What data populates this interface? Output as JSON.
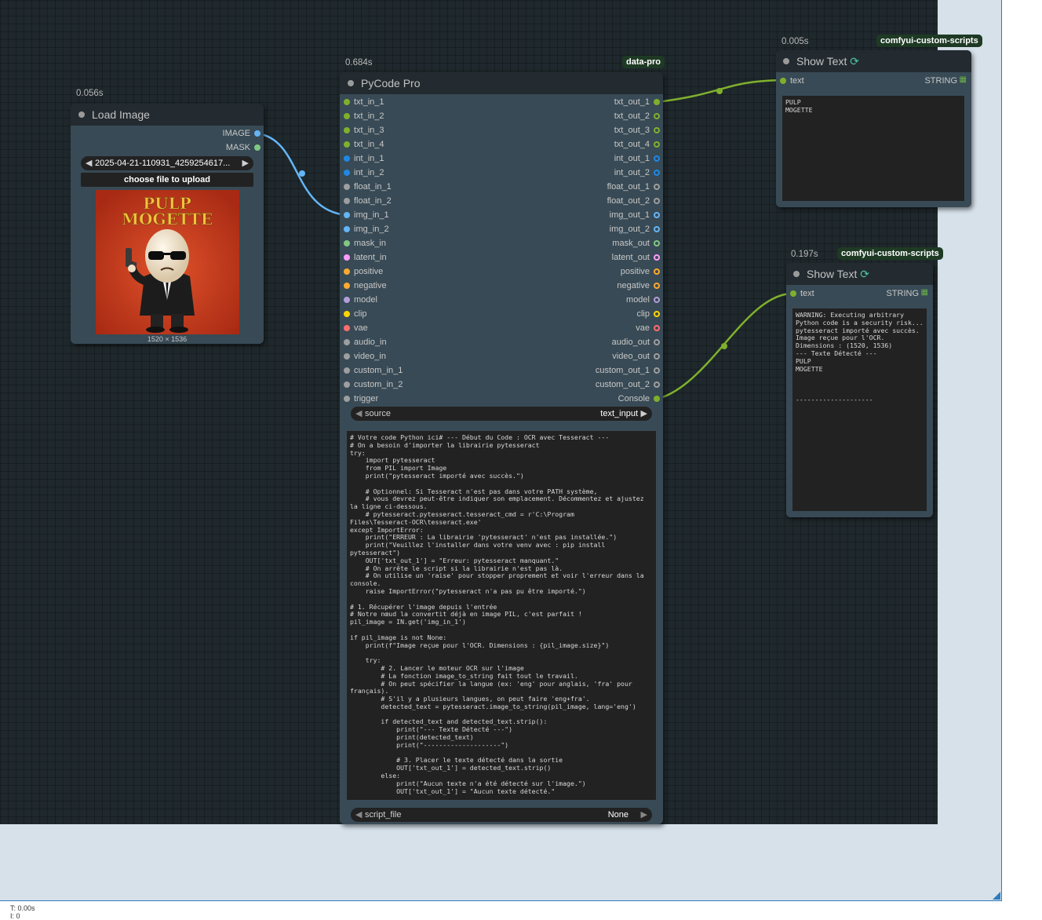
{
  "colors": {
    "wire_string": "#7fb02d",
    "wire_image": "#64b5f6",
    "badge_bg": "#1e3a24"
  },
  "load_image": {
    "timing": "0.056s",
    "title": "Load Image",
    "outputs": [
      {
        "label": "IMAGE",
        "color": "#64b5f6"
      },
      {
        "label": "MASK",
        "color": "#81c784"
      }
    ],
    "image_combo": "2025-04-21-110931_4259254617...",
    "upload_button": "choose file to upload",
    "poster_line1": "PULP",
    "poster_line2": "MOGETTE",
    "dimensions": "1520 × 1536"
  },
  "pycode": {
    "timing": "0.684s",
    "badge": "data-pro",
    "title": "PyCode Pro",
    "inputs": [
      {
        "label": "txt_in_1",
        "color": "#7fb02d"
      },
      {
        "label": "txt_in_2",
        "color": "#7fb02d"
      },
      {
        "label": "txt_in_3",
        "color": "#7fb02d"
      },
      {
        "label": "txt_in_4",
        "color": "#7fb02d"
      },
      {
        "label": "int_in_1",
        "color": "#1e88e5"
      },
      {
        "label": "int_in_2",
        "color": "#1e88e5"
      },
      {
        "label": "float_in_1",
        "color": "#9e9e9e"
      },
      {
        "label": "float_in_2",
        "color": "#9e9e9e"
      },
      {
        "label": "img_in_1",
        "color": "#64b5f6"
      },
      {
        "label": "img_in_2",
        "color": "#64b5f6"
      },
      {
        "label": "mask_in",
        "color": "#81c784"
      },
      {
        "label": "latent_in",
        "color": "#ff9cf9"
      },
      {
        "label": "positive",
        "color": "#ffa931"
      },
      {
        "label": "negative",
        "color": "#ffa931"
      },
      {
        "label": "model",
        "color": "#b39ddb"
      },
      {
        "label": "clip",
        "color": "#ffd500"
      },
      {
        "label": "vae",
        "color": "#ff6e6e"
      },
      {
        "label": "audio_in",
        "color": "#9e9e9e"
      },
      {
        "label": "video_in",
        "color": "#9e9e9e"
      },
      {
        "label": "custom_in_1",
        "color": "#9e9e9e"
      },
      {
        "label": "custom_in_2",
        "color": "#9e9e9e"
      },
      {
        "label": "trigger",
        "color": "#9e9e9e"
      }
    ],
    "outputs": [
      {
        "label": "txt_out_1",
        "color": "#7fb02d",
        "hollow": false
      },
      {
        "label": "txt_out_2",
        "color": "#7fb02d",
        "hollow": true
      },
      {
        "label": "txt_out_3",
        "color": "#7fb02d",
        "hollow": true
      },
      {
        "label": "txt_out_4",
        "color": "#7fb02d",
        "hollow": true
      },
      {
        "label": "int_out_1",
        "color": "#1e88e5",
        "hollow": true
      },
      {
        "label": "int_out_2",
        "color": "#1e88e5",
        "hollow": true
      },
      {
        "label": "float_out_1",
        "color": "#9e9e9e",
        "hollow": true
      },
      {
        "label": "float_out_2",
        "color": "#9e9e9e",
        "hollow": true
      },
      {
        "label": "img_out_1",
        "color": "#64b5f6",
        "hollow": true
      },
      {
        "label": "img_out_2",
        "color": "#64b5f6",
        "hollow": true
      },
      {
        "label": "mask_out",
        "color": "#81c784",
        "hollow": true
      },
      {
        "label": "latent_out",
        "color": "#ff9cf9",
        "hollow": true
      },
      {
        "label": "positive",
        "color": "#ffa931",
        "hollow": true
      },
      {
        "label": "negative",
        "color": "#ffa931",
        "hollow": true
      },
      {
        "label": "model",
        "color": "#b39ddb",
        "hollow": true
      },
      {
        "label": "clip",
        "color": "#ffd500",
        "hollow": true
      },
      {
        "label": "vae",
        "color": "#ff6e6e",
        "hollow": true
      },
      {
        "label": "audio_out",
        "color": "#9e9e9e",
        "hollow": true
      },
      {
        "label": "video_out",
        "color": "#9e9e9e",
        "hollow": true
      },
      {
        "label": "custom_out_1",
        "color": "#9e9e9e",
        "hollow": true
      },
      {
        "label": "custom_out_2",
        "color": "#9e9e9e",
        "hollow": true
      },
      {
        "label": "Console",
        "color": "#7fb02d",
        "hollow": false
      }
    ],
    "source_label": "source",
    "source_value": "text_input",
    "script_file_label": "script_file",
    "script_file_value": "None",
    "code": "# Votre code Python ici# --- Début du Code : OCR avec Tesseract ---\n# On a besoin d'importer la librairie pytesseract\ntry:\n    import pytesseract\n    from PIL import Image\n    print(\"pytesseract importé avec succès.\")\n\n    # Optionnel: Si Tesseract n'est pas dans votre PATH système,\n    # vous devrez peut-être indiquer son emplacement. Décommentez et ajustez\nla ligne ci-dessous.\n    # pytesseract.pytesseract.tesseract_cmd = r'C:\\Program\nFiles\\Tesseract-OCR\\tesseract.exe'\nexcept ImportError:\n    print(\"ERREUR : La librairie 'pytesseract' n'est pas installée.\")\n    print(\"Veuillez l'installer dans votre venv avec : pip install\npytesseract\")\n    OUT['txt_out_1'] = \"Erreur: pytesseract manquant.\"\n    # On arrête le script si la librairie n'est pas là.\n    # On utilise un 'raise' pour stopper proprement et voir l'erreur dans la\nconsole.\n    raise ImportError(\"pytesseract n'a pas pu être importé.\")\n\n# 1. Récupérer l'image depuis l'entrée\n# Notre nœud la convertit déjà en image PIL, c'est parfait !\npil_image = IN.get('img_in_1')\n\nif pil_image is not None:\n    print(f\"Image reçue pour l'OCR. Dimensions : {pil_image.size}\")\n\n    try:\n        # 2. Lancer le moteur OCR sur l'image\n        # La fonction image_to_string fait tout le travail.\n        # On peut spécifier la langue (ex: 'eng' pour anglais, 'fra' pour\nfrançais).\n        # S'il y a plusieurs langues, on peut faire 'eng+fra'.\n        detected_text = pytesseract.image_to_string(pil_image, lang='eng')\n\n        if detected_text and detected_text.strip():\n            print(\"--- Texte Détecté ---\")\n            print(detected_text)\n            print(\"--------------------\")\n\n            # 3. Placer le texte détecté dans la sortie\n            OUT['txt_out_1'] = detected_text.strip()\n        else:\n            print(\"Aucun texte n'a été détecté sur l'image.\")\n            OUT['txt_out_1'] = \"Aucun texte détecté.\"\n\n    except pytesseract.TesseractNotFoundError:\n        error_msg = \"ERREUR : Tesseract n'est pas installé ou n'est pas dans\nle PATH système.\"\n        print(error_msg)\n        print(\"Veuillez installer Tesseract OCR depuis le site officiel et\nvous assurer qu'il est accessible.\")\n        OUT['txt_out_1'] = error_msg\n    except Exception as e:\n        error_msg = f\"Une erreur inattendue est survenue pendant l'OCR : {e}\""
  },
  "show_text_1": {
    "timing": "0.005s",
    "badge": "comfyui-custom-scripts",
    "title": "Show Text",
    "input_label": "text",
    "output_label": "STRING",
    "content": "PULP\nMOGETTE"
  },
  "show_text_2": {
    "timing": "0.197s",
    "badge": "comfyui-custom-scripts",
    "title": "Show Text",
    "input_label": "text",
    "output_label": "STRING",
    "content": "WARNING: Executing arbitrary\nPython code is a security risk...\npytesseract importé avec succès.\nImage reçue pour l'OCR.\nDimensions : (1520, 1536)\n--- Texte Détecté ---\nPULP\nMOGETTE\n\n\n\n--------------------"
  },
  "status": {
    "line1": "T: 0.00s",
    "line2": "I: 0"
  }
}
